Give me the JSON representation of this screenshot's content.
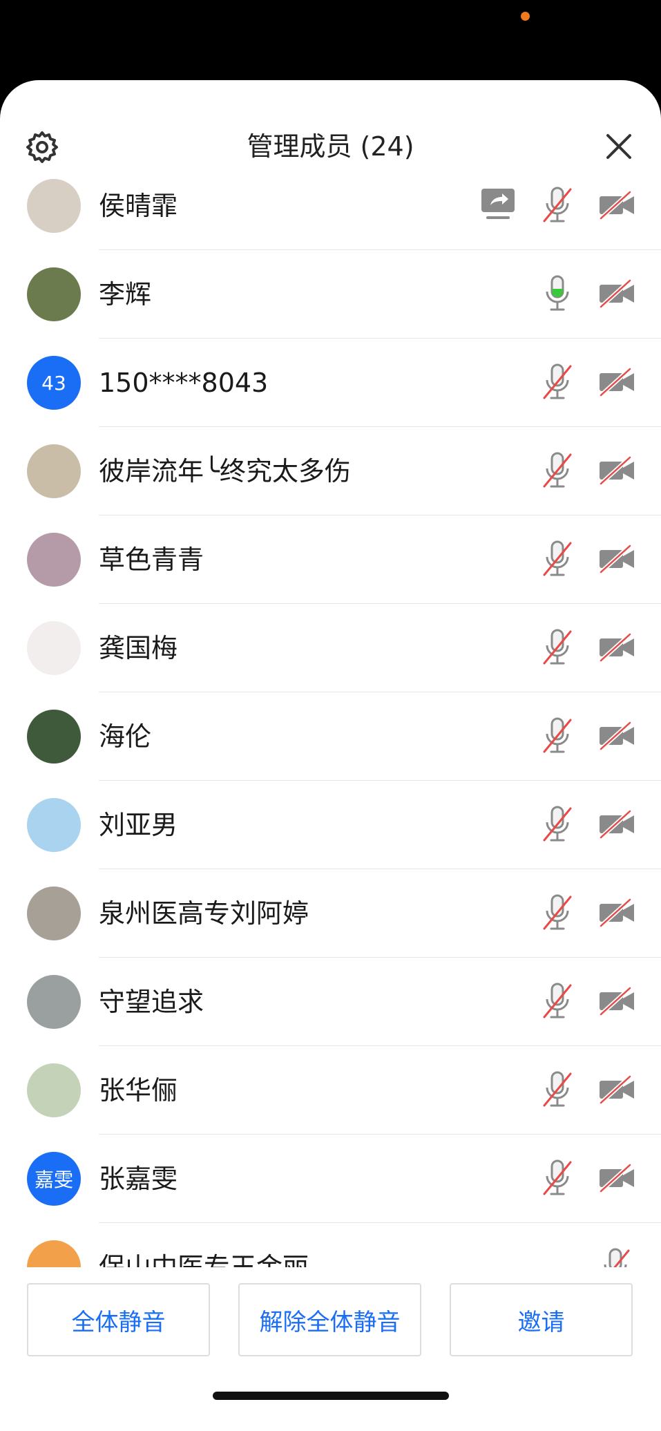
{
  "header": {
    "title": "管理成员 (24)"
  },
  "members": [
    {
      "name": "侯晴霏",
      "avatar_text": "",
      "avatar_color": "#d8cfc4",
      "sharing": true,
      "mic": "muted"
    },
    {
      "name": "李辉",
      "avatar_text": "",
      "avatar_color": "#6b7b4e",
      "sharing": false,
      "mic": "active"
    },
    {
      "name": "150****8043",
      "avatar_text": "43",
      "avatar_color": "#1a6ef5",
      "sharing": false,
      "mic": "muted"
    },
    {
      "name": "彼岸流年╰终究太多伤",
      "avatar_text": "",
      "avatar_color": "#c9bda8",
      "sharing": false,
      "mic": "muted"
    },
    {
      "name": "草色青青",
      "avatar_text": "",
      "avatar_color": "#b59aa8",
      "sharing": false,
      "mic": "muted"
    },
    {
      "name": "龚国梅",
      "avatar_text": "",
      "avatar_color": "#f2eeee",
      "sharing": false,
      "mic": "muted"
    },
    {
      "name": "海伦",
      "avatar_text": "",
      "avatar_color": "#3f5a3a",
      "sharing": false,
      "mic": "muted"
    },
    {
      "name": "刘亚男",
      "avatar_text": "",
      "avatar_color": "#a9d3ee",
      "sharing": false,
      "mic": "muted"
    },
    {
      "name": "泉州医高专刘阿婷",
      "avatar_text": "",
      "avatar_color": "#a6a096",
      "sharing": false,
      "mic": "muted"
    },
    {
      "name": "守望追求",
      "avatar_text": "",
      "avatar_color": "#9aa0a0",
      "sharing": false,
      "mic": "muted"
    },
    {
      "name": "张华俪",
      "avatar_text": "",
      "avatar_color": "#c4d3b8",
      "sharing": false,
      "mic": "muted"
    },
    {
      "name": "张嘉雯",
      "avatar_text": "嘉雯",
      "avatar_color": "#1a6ef5",
      "sharing": false,
      "mic": "muted"
    },
    {
      "name": "保山中医专王金丽",
      "avatar_text": "",
      "avatar_color": "#f3a04a",
      "sharing": false,
      "mic": "muted"
    }
  ],
  "actions": {
    "mute_all": "全体静音",
    "unmute_all": "解除全体静音",
    "invite": "邀请"
  },
  "colors": {
    "accent": "#1a6ef5",
    "mute_slash": "#e84a4a",
    "mic_active": "#3cc83c"
  }
}
